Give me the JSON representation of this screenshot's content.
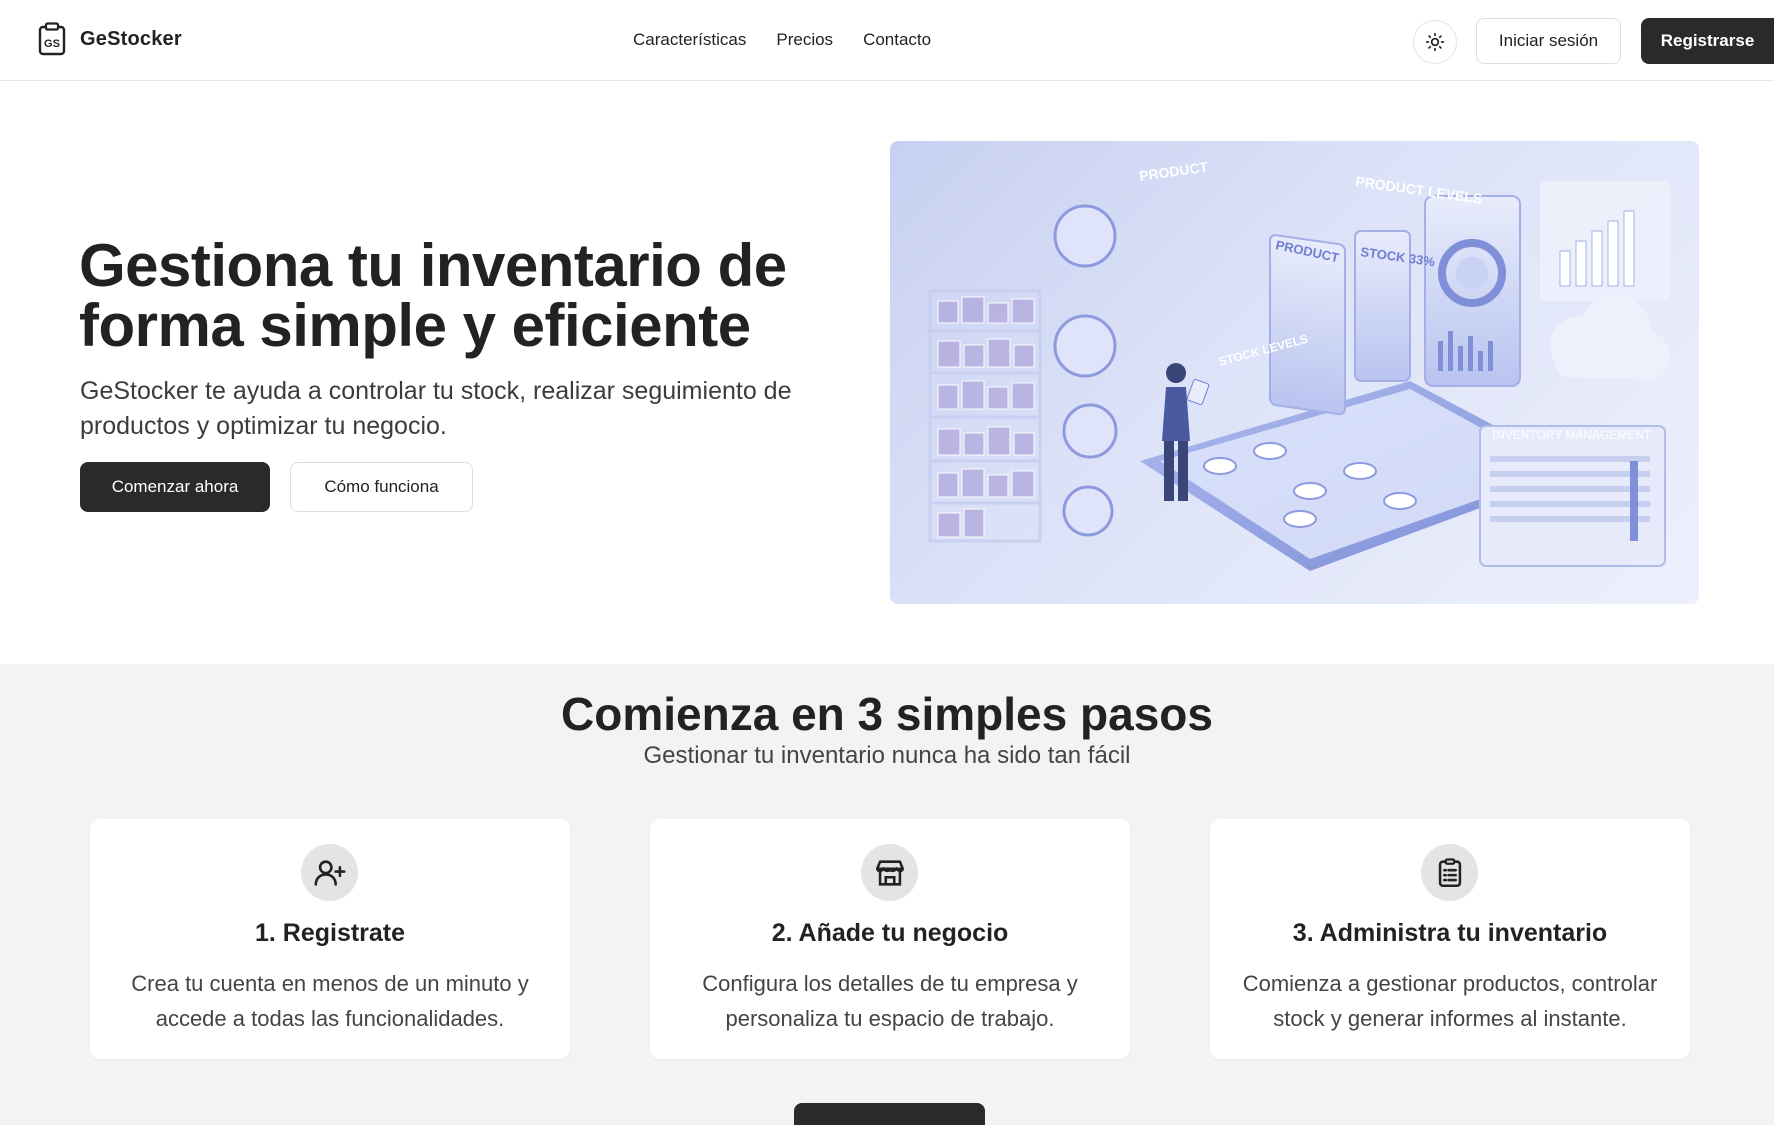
{
  "header": {
    "brand": "GeStocker",
    "logo_text": "GS",
    "nav": [
      "Características",
      "Precios",
      "Contacto"
    ],
    "theme_icon": "sun-icon",
    "login_label": "Iniciar sesión",
    "register_label": "Registrarse"
  },
  "hero": {
    "title": "Gestiona tu inventario de forma simple y eficiente",
    "subtitle": "GeStocker te ayuda a controlar tu stock, realizar seguimiento de productos y optimizar tu negocio.",
    "primary_cta": "Comenzar ahora",
    "secondary_cta": "Cómo funciona",
    "illustration_labels": [
      "PRODUCT",
      "PRODUCT LEVELS",
      "PRODUCT",
      "STOCK 33%",
      "STOCK LEVELS",
      "INVENTORY MANAGEMENT"
    ]
  },
  "steps": {
    "title": "Comienza en 3 simples pasos",
    "subtitle": "Gestionar tu inventario nunca ha sido tan fácil",
    "cards": [
      {
        "icon": "user-plus-icon",
        "title": "1. Registrate",
        "text": "Crea tu cuenta en menos de un minuto y accede a todas las funcionalidades."
      },
      {
        "icon": "store-icon",
        "title": "2. Añade tu negocio",
        "text": "Configura los detalles de tu empresa y personaliza tu espacio de trabajo."
      },
      {
        "icon": "clipboard-list-icon",
        "title": "3. Administra tu inventario",
        "text": "Comienza a gestionar productos, controlar stock y generar informes al instante."
      }
    ]
  },
  "colors": {
    "primary": "#2a2a2a",
    "section_bg": "#f3f3f3",
    "illustration_accent": "#7f8fd8"
  }
}
